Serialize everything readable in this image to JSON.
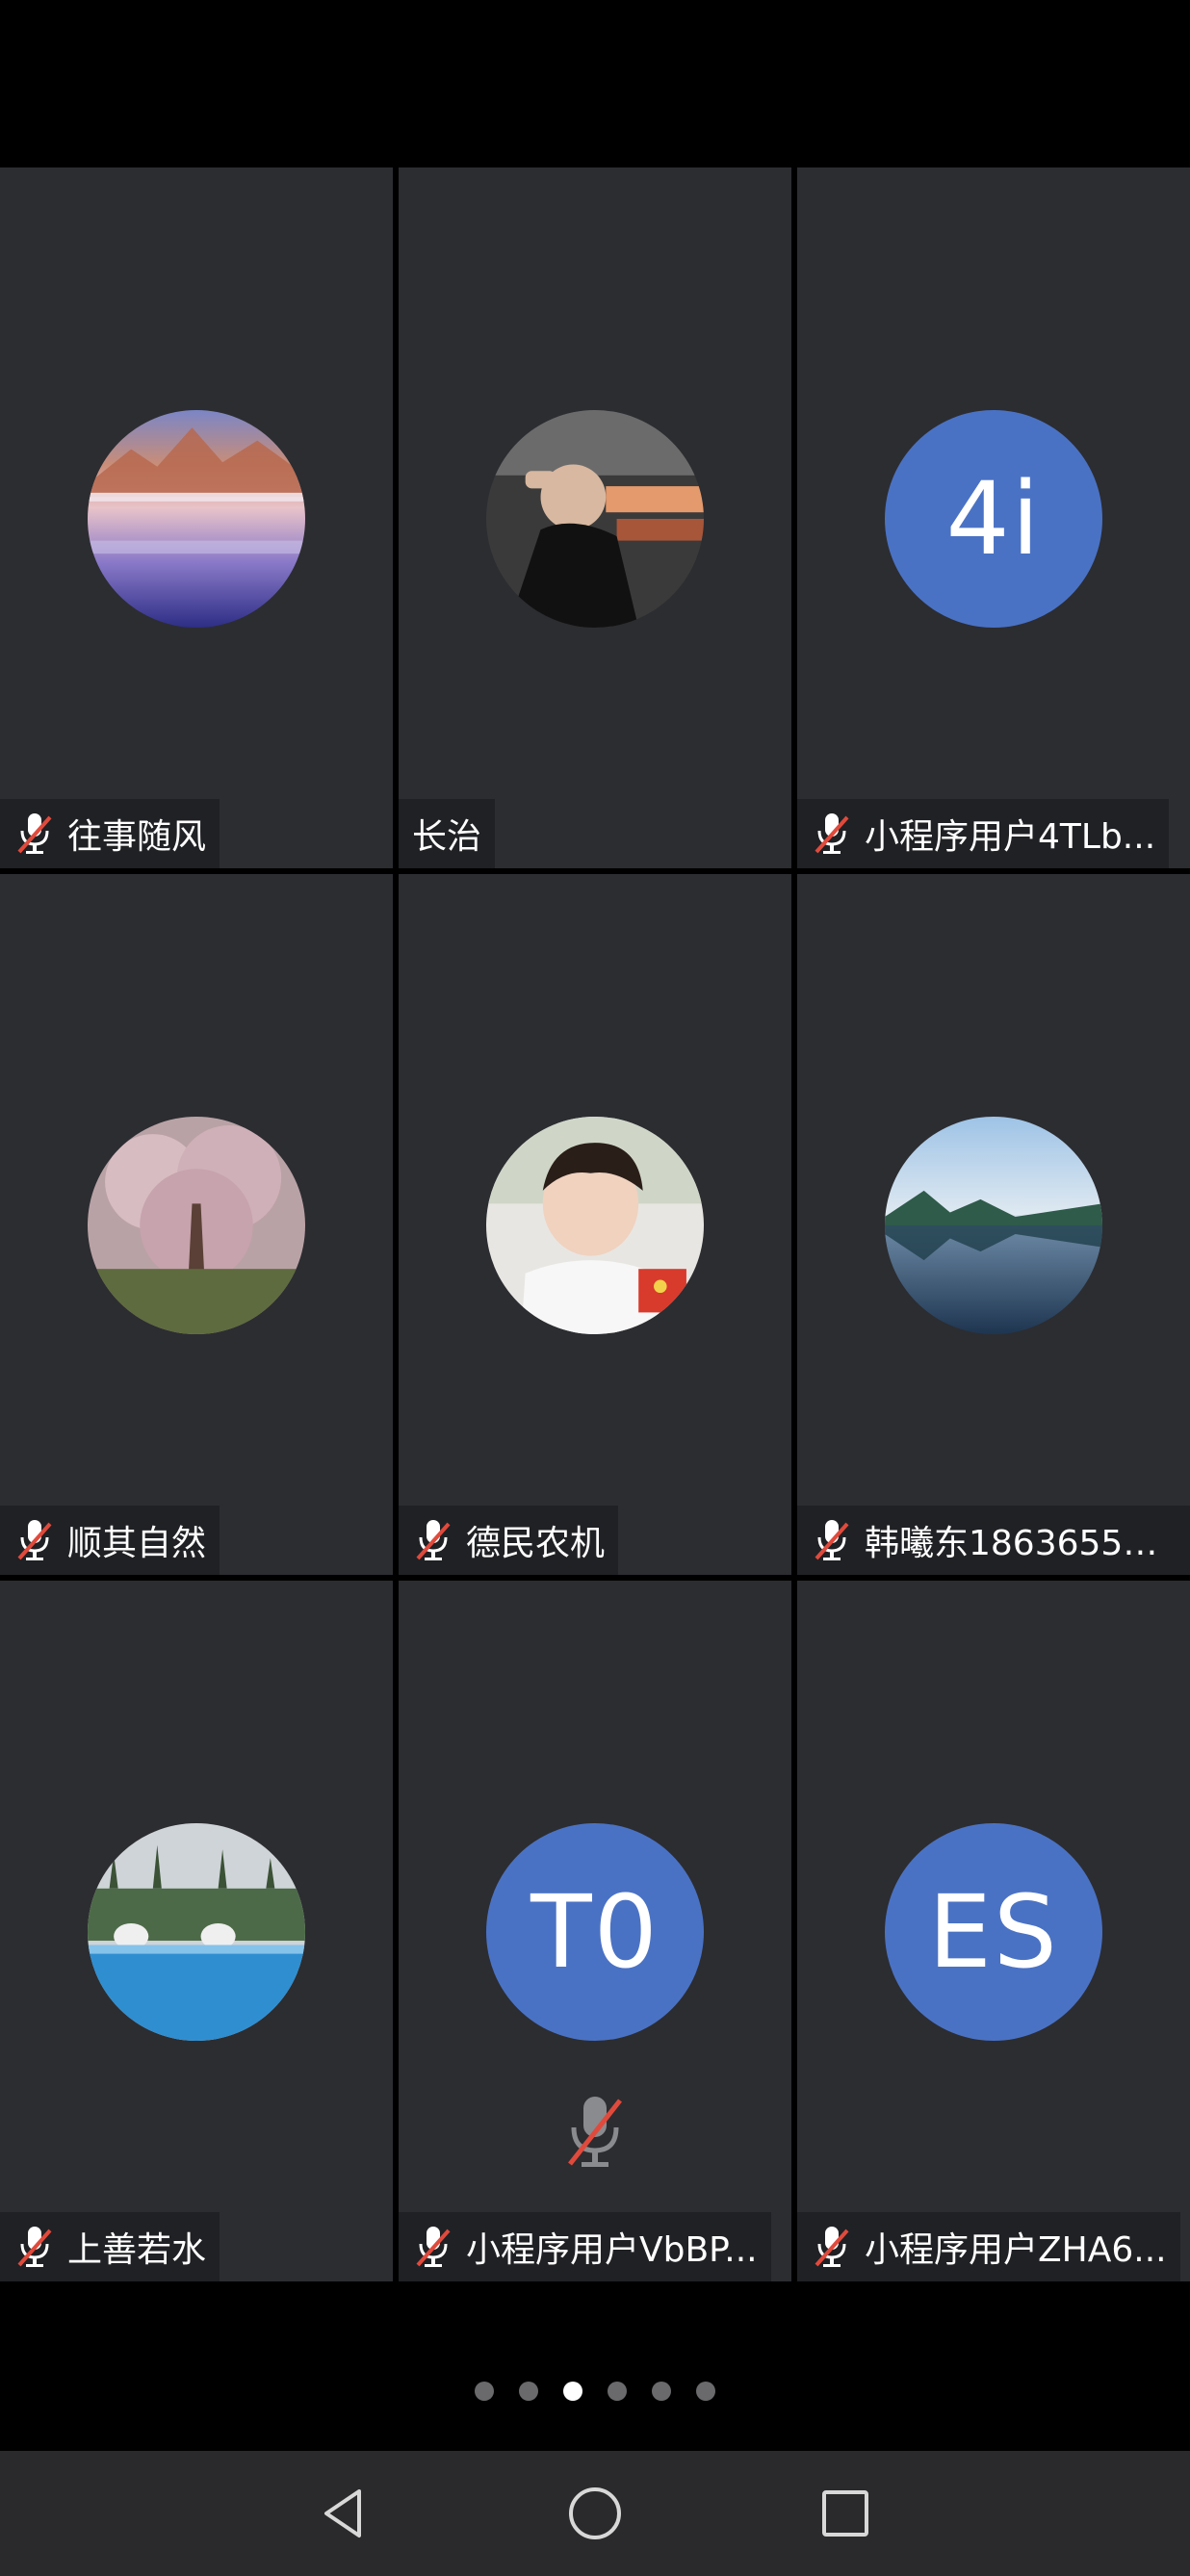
{
  "participants": [
    {
      "name": "往事随风",
      "muted": true,
      "avatar_type": "photo",
      "avatar": "snowy-mountain-lake-photo"
    },
    {
      "name": "长治",
      "muted": false,
      "avatar_type": "photo",
      "avatar": "person-selfie-photo"
    },
    {
      "name": "小程序用户4TLb...",
      "muted": true,
      "avatar_type": "initials",
      "initials": "4i"
    },
    {
      "name": "顺其自然",
      "muted": true,
      "avatar_type": "photo",
      "avatar": "blossom-tree-photo"
    },
    {
      "name": "德民农机",
      "muted": true,
      "avatar_type": "photo",
      "avatar": "child-portrait-photo"
    },
    {
      "name": "韩曦东18636559...",
      "muted": true,
      "avatar_type": "photo",
      "avatar": "mountain-lake-reflection-photo"
    },
    {
      "name": "上善若水",
      "muted": true,
      "avatar_type": "photo",
      "avatar": "resort-pool-photo"
    },
    {
      "name": "小程序用户VbBP...",
      "muted": true,
      "avatar_type": "initials",
      "initials": "T0"
    },
    {
      "name": "小程序用户ZHA6...",
      "muted": true,
      "avatar_type": "initials",
      "initials": "ES"
    }
  ],
  "pagination": {
    "total_pages": 6,
    "current_page": 3
  },
  "navigation": {
    "back": "back-icon",
    "home": "home-icon",
    "recents": "recents-icon"
  },
  "colors": {
    "tile_bg": "#2c2d31",
    "avatar_initials_bg": "#4a72c4",
    "muted_slash": "#e04a3c"
  }
}
